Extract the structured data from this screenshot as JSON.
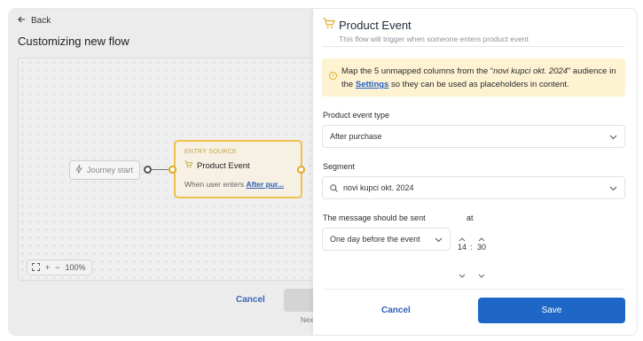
{
  "background": {
    "back_label": "Back",
    "page_title": "Customizing new flow",
    "canvas": {
      "journey_start_label": "Journey start",
      "entry_source_label": "ENTRY SOURCE",
      "entry_title": "Product Event",
      "entry_sub_prefix": "When user enters",
      "entry_sub_link": "After pur..."
    },
    "zoom": {
      "level": "100%"
    },
    "cancel_label": "Cancel",
    "next_label": "Nex"
  },
  "panel": {
    "title": "Product Event",
    "subtitle": "This flow will trigger when someone enters product event",
    "notice": {
      "text_before": "Map the 5 unmapped columns from the “",
      "audience": "novi kupci okt. 2024",
      "text_middle": "” audience in the ",
      "link": "Settings",
      "text_after": " so they can be used as placeholders in content."
    },
    "product_event_type": {
      "label": "Product event type",
      "value": "After purchase"
    },
    "segment": {
      "label": "Segment",
      "value": "novi kupci okt. 2024"
    },
    "send": {
      "label": "The message should be sent",
      "at_label": "at",
      "value": "One day before the event",
      "hour": "14",
      "separator": ":",
      "minute": "30"
    },
    "footer": {
      "cancel_label": "Cancel",
      "save_label": "Save"
    }
  },
  "colors": {
    "accent": "#1f67c6",
    "notice_bg": "#fdf3d3",
    "entry_border": "#f0c24d"
  }
}
